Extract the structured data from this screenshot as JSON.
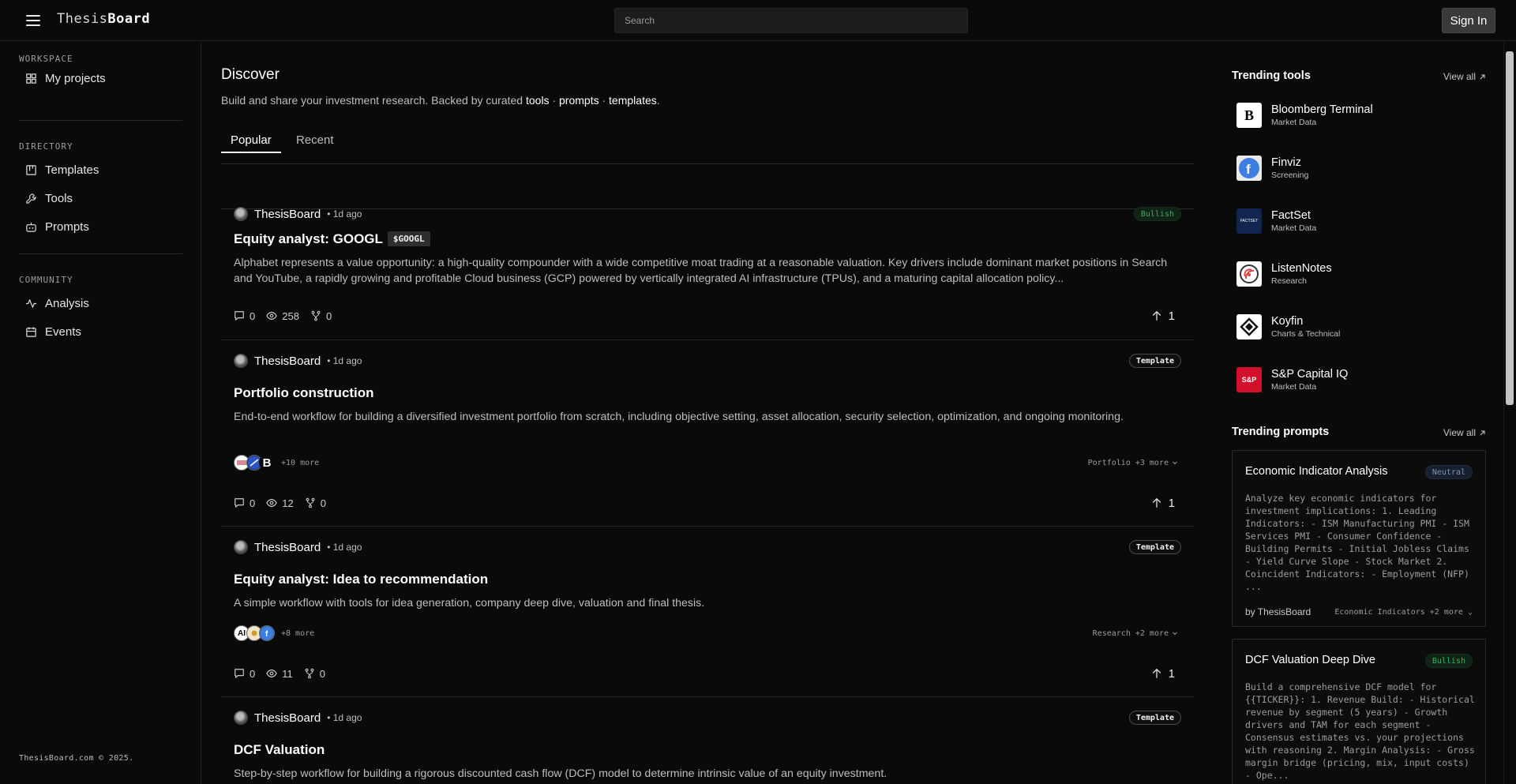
{
  "brand": {
    "prefix": "Thesis",
    "suffix": "Board"
  },
  "search": {
    "placeholder": "Search",
    "value": ""
  },
  "header": {
    "signin_label": "Sign In"
  },
  "sidebar": {
    "workspace_title": "WORKSPACE",
    "workspace_items": [
      {
        "label": "My projects",
        "icon": "grid-icon"
      }
    ],
    "directory_title": "DIRECTORY",
    "directory_items": [
      {
        "label": "Templates",
        "icon": "kanban-icon"
      },
      {
        "label": "Tools",
        "icon": "wrench-icon"
      },
      {
        "label": "Prompts",
        "icon": "bot-icon"
      }
    ],
    "community_title": "COMMUNITY",
    "community_items": [
      {
        "label": "Analysis",
        "icon": "activity-icon"
      },
      {
        "label": "Events",
        "icon": "calendar-icon"
      }
    ],
    "footer": "ThesisBoard.com © 2025."
  },
  "main": {
    "title": "Discover",
    "subtitle_prefix": "Build and share your investment research. Backed by curated ",
    "subtitle_links": [
      "tools",
      "prompts",
      "templates"
    ],
    "subtitle_sep": " · ",
    "subtitle_suffix": ".",
    "tabs": [
      "Popular",
      "Recent"
    ],
    "active_tab": "Popular",
    "posts": [
      {
        "author": "ThesisBoard",
        "time": "• 1d ago",
        "badge": "Bullish",
        "title": "Equity analyst: GOOGL",
        "ticker": "$GOOGL",
        "desc": "Alphabet represents a value opportunity: a high-quality compounder with a wide competitive moat trading at a reasonable valuation. Key drivers include dominant market positions in Search and YouTube, a rapidly growing and profitable Cloud business (GCP) powered by vertically integrated AI infrastructure (TPUs), and a maturing capital allocation policy...",
        "comments": "0",
        "views": "258",
        "forks": "0",
        "upvotes": "1"
      },
      {
        "author": "ThesisBoard",
        "time": "• 1d ago",
        "badge": "Template",
        "title": "Portfolio construction",
        "desc": "End-to-end workflow for building a diversified investment portfolio from scratch, including objective setting, asset allocation, security selection, optimization, and ongoing monitoring.",
        "tools_more": "+10 more",
        "tag_select": "Portfolio +3 more",
        "comments": "0",
        "views": "12",
        "forks": "0",
        "upvotes": "1"
      },
      {
        "author": "ThesisBoard",
        "time": "• 1d ago",
        "badge": "Template",
        "title": "Equity analyst: Idea to recommendation",
        "desc": "A simple workflow with tools for idea generation, company deep dive, valuation and final thesis.",
        "tools_more": "+8 more",
        "tag_select": "Research +2 more",
        "comments": "0",
        "views": "11",
        "forks": "0",
        "upvotes": "1"
      },
      {
        "author": "ThesisBoard",
        "time": "• 1d ago",
        "badge": "Template",
        "title": "DCF Valuation",
        "desc": "Step-by-step workflow for building a rigorous discounted cash flow (DCF) model to determine intrinsic value of an equity investment."
      }
    ]
  },
  "right": {
    "tools_title": "Trending tools",
    "view_all": "View all",
    "tools": [
      {
        "name": "Bloomberg Terminal",
        "category": "Market Data",
        "logo_text": "B",
        "icon": "bloomberg-logo-icon"
      },
      {
        "name": "Finviz",
        "category": "Screening",
        "logo_text": "f",
        "icon": "finviz-logo-icon"
      },
      {
        "name": "FactSet",
        "category": "Market Data",
        "logo_text": "FACTSET",
        "icon": "factset-logo-icon"
      },
      {
        "name": "ListenNotes",
        "category": "Research",
        "logo_text": "",
        "icon": "listennotes-logo-icon"
      },
      {
        "name": "Koyfin",
        "category": "Charts & Technical",
        "logo_text": "",
        "icon": "koyfin-logo-icon"
      },
      {
        "name": "S&P Capital IQ",
        "category": "Market Data",
        "logo_text": "S&P",
        "icon": "spcapitaliq-logo-icon"
      }
    ],
    "prompts_title": "Trending prompts",
    "prompts": [
      {
        "title": "Economic Indicator Analysis",
        "badge": "Neutral",
        "body": "Analyze key economic indicators for investment implications: 1. Leading Indicators: - ISM Manufacturing PMI - ISM Services PMI - Consumer Confidence - Building Permits - Initial Jobless Claims - Yield Curve Slope - Stock Market 2. Coincident Indicators: - Employment (NFP) ...",
        "by": "by ThesisBoard",
        "tag": "Economic Indicators +2 more"
      },
      {
        "title": "DCF Valuation Deep Dive",
        "badge": "Bullish",
        "body": "Build a comprehensive DCF model for {{TICKER}}: 1. Revenue Build: - Historical revenue by segment (5 years) - Growth drivers and TAM for each segment - Consensus estimates vs. your projections with reasoning 2. Margin Analysis: - Gross margin bridge (pricing, mix, input costs) - Ope..."
      }
    ]
  },
  "colors": {
    "background": "#0a0a0a",
    "bullish": "#3fae60",
    "neutral": "#7f92b8",
    "text": "#e8e8e8"
  }
}
